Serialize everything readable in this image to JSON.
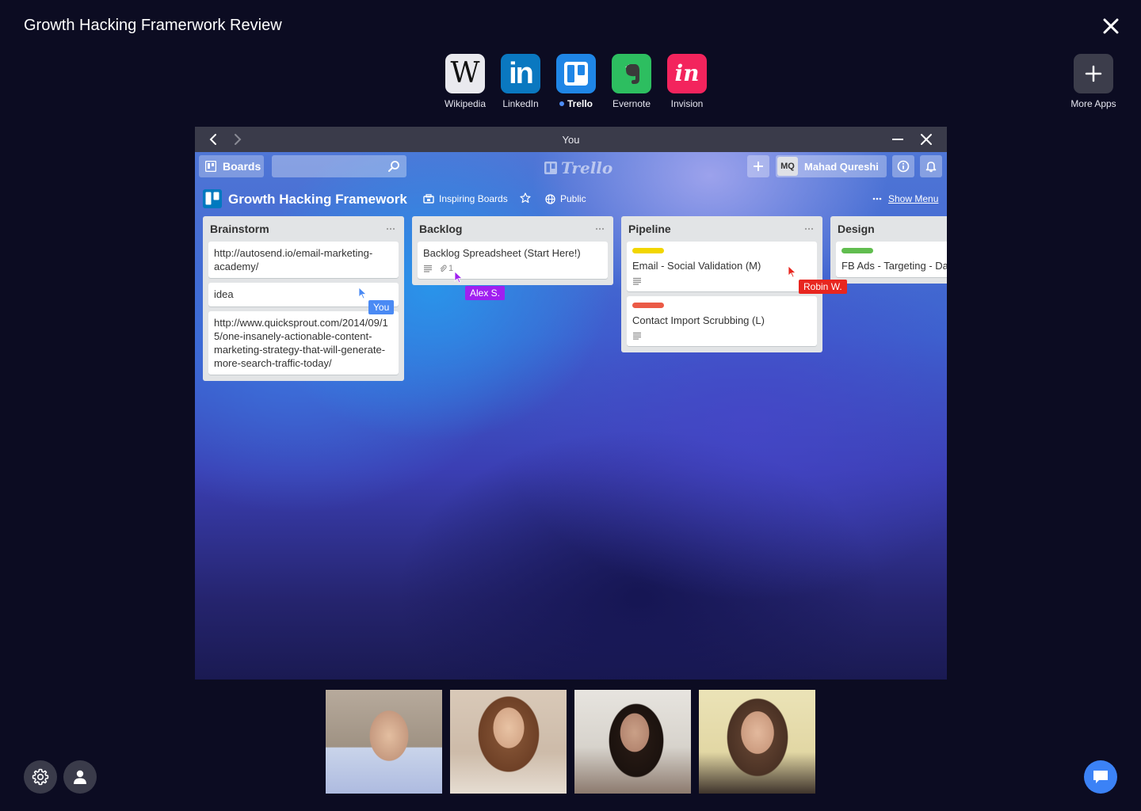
{
  "session": {
    "title": "Growth Hacking Framerwork Review"
  },
  "apps": [
    {
      "name": "Wikipedia",
      "icon": "wikipedia-icon",
      "color": "#e9e9ee",
      "active": false
    },
    {
      "name": "LinkedIn",
      "icon": "linkedin-icon",
      "color": "#0a78c0",
      "active": false
    },
    {
      "name": "Trello",
      "icon": "trello-icon",
      "color": "#1f86e6",
      "active": true
    },
    {
      "name": "Evernote",
      "icon": "evernote-icon",
      "color": "#2dbe60",
      "active": false
    },
    {
      "name": "Invision",
      "icon": "invision-icon",
      "color": "#f3245d",
      "active": false
    }
  ],
  "more_apps": {
    "label": "More Apps",
    "icon": "plus-icon"
  },
  "window": {
    "title": "You"
  },
  "trello": {
    "boards_label": "Boards",
    "search_placeholder": "",
    "logo_text": "Trello",
    "member_initials": "MQ",
    "member_name": "Mahad Qureshi",
    "board": {
      "name": "Growth Hacking Framework",
      "team": "Inspiring Boards",
      "visibility": "Public",
      "show_menu": "Show Menu"
    },
    "lists": [
      {
        "title": "Brainstorm",
        "cards": [
          {
            "text": "http://autosend.io/email-marketing-academy/"
          },
          {
            "text": "idea"
          },
          {
            "text": "http://www.quicksprout.com/2014/09/15/one-insanely-actionable-content-marketing-strategy-that-will-generate-more-search-traffic-today/"
          }
        ]
      },
      {
        "title": "Backlog",
        "cards": [
          {
            "text": "Backlog Spreadsheet (Start Here!)",
            "has_description": true,
            "attachments": "1"
          }
        ]
      },
      {
        "title": "Pipeline",
        "cards": [
          {
            "text": "Email - Social Validation (M)",
            "label_color": "#f2d600",
            "has_description": true
          },
          {
            "text": "Contact Import Scrubbing (L)",
            "label_color": "#eb5a46",
            "has_description": true
          }
        ]
      },
      {
        "title": "Design",
        "cards": [
          {
            "text": "FB Ads - Targeting - Da (S)",
            "label_color": "#61bd4f"
          }
        ]
      }
    ]
  },
  "cursors": [
    {
      "name": "You",
      "color": "#4a8af4"
    },
    {
      "name": "Alex S.",
      "color": "#a020f0"
    },
    {
      "name": "Robin W.",
      "color": "#e8261f"
    }
  ],
  "participants": [
    {
      "id": "participant-1"
    },
    {
      "id": "participant-2"
    },
    {
      "id": "participant-3"
    },
    {
      "id": "participant-4"
    }
  ],
  "controls": {
    "settings_icon": "gear-icon",
    "profile_icon": "user-icon",
    "chat_icon": "chat-icon"
  }
}
